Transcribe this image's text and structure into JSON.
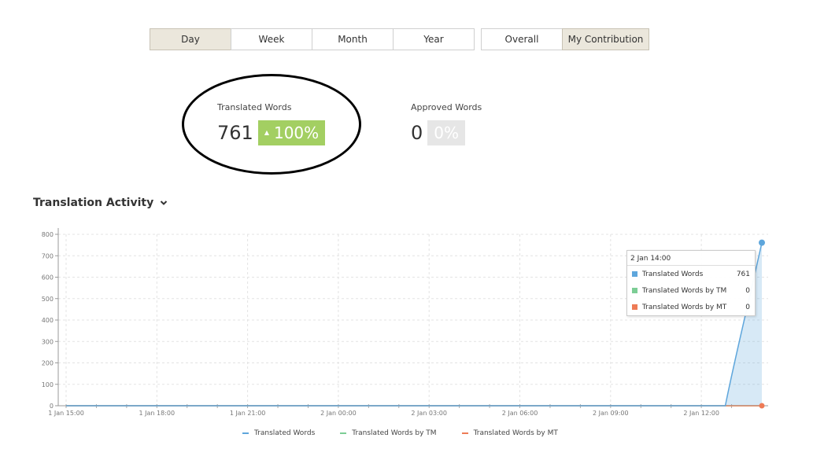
{
  "period_tabs": [
    {
      "label": "Day",
      "active": true
    },
    {
      "label": "Week",
      "active": false
    },
    {
      "label": "Month",
      "active": false
    },
    {
      "label": "Year",
      "active": false
    }
  ],
  "scope_tabs": [
    {
      "label": "Overall",
      "active": false
    },
    {
      "label": "My Contribution",
      "active": true
    }
  ],
  "stats": {
    "translated": {
      "label": "Translated Words",
      "value": "761",
      "change": "100%"
    },
    "approved": {
      "label": "Approved Words",
      "value": "0",
      "change": "0%"
    }
  },
  "activity": {
    "title": "Translation Activity"
  },
  "colors": {
    "translated": "#5ea6dc",
    "tm": "#7ccd95",
    "mt": "#ee7b56",
    "positive": "#a3cf62",
    "neutral": "#e6e6e6"
  },
  "icons": {
    "dropdown": "chevron-down-icon",
    "increase": "triangle-up-icon"
  },
  "chart_data": {
    "type": "area",
    "x_ticks": [
      "1 Jan 15:00",
      "1 Jan 18:00",
      "1 Jan 21:00",
      "2 Jan 00:00",
      "2 Jan 03:00",
      "2 Jan 06:00",
      "2 Jan 09:00",
      "2 Jan 12:00"
    ],
    "y_ticks": [
      0,
      100,
      200,
      300,
      400,
      500,
      600,
      700,
      800
    ],
    "xlim_hours": [
      0,
      23
    ],
    "ylim": [
      0,
      800
    ],
    "series": [
      {
        "name": "Translated Words",
        "color": "#5ea6dc",
        "points": [
          [
            0,
            0
          ],
          [
            21,
            0
          ],
          [
            22,
            0
          ],
          [
            23,
            761
          ]
        ]
      },
      {
        "name": "Translated Words by TM",
        "color": "#7ccd95",
        "points": [
          [
            0,
            0
          ],
          [
            23,
            0
          ]
        ]
      },
      {
        "name": "Translated Words by MT",
        "color": "#ee7b56",
        "points": [
          [
            0,
            0
          ],
          [
            23,
            0
          ]
        ]
      }
    ],
    "grid": true,
    "legend": "bottom",
    "tooltip": {
      "title": "2 Jan 14:00",
      "rows": [
        {
          "name": "Translated Words",
          "value": "761"
        },
        {
          "name": "Translated Words by TM",
          "value": "0"
        },
        {
          "name": "Translated Words by MT",
          "value": "0"
        }
      ]
    }
  }
}
